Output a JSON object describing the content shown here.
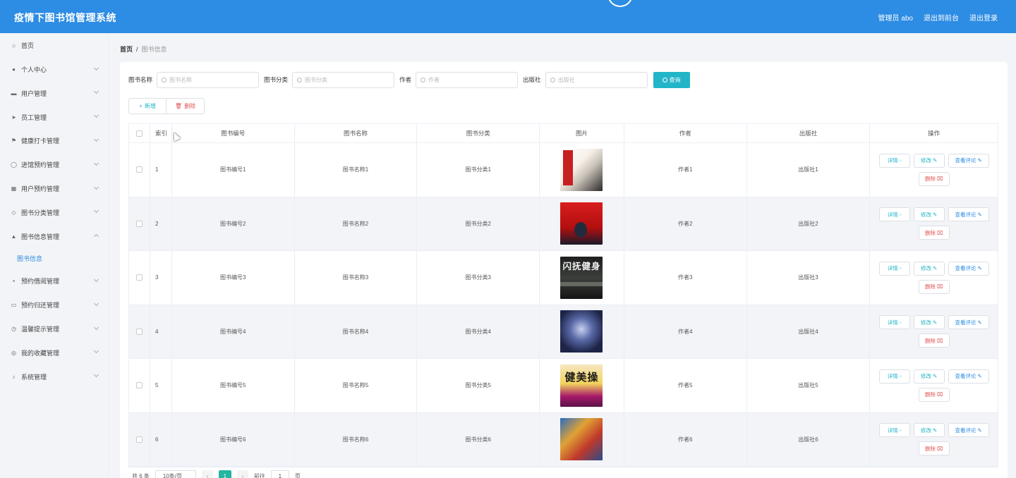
{
  "header": {
    "title": "疫情下图书馆管理系统",
    "admin_label": "管理员 abo",
    "back_front": "退出到前台",
    "logout": "退出登录"
  },
  "sidebar": {
    "items": [
      {
        "label": "首页",
        "icon": "home-icon",
        "has_arrow": false
      },
      {
        "label": "个人中心",
        "icon": "user-icon",
        "has_arrow": true
      },
      {
        "label": "用户管理",
        "icon": "id-card-icon",
        "has_arrow": true
      },
      {
        "label": "员工管理",
        "icon": "send-icon",
        "has_arrow": true
      },
      {
        "label": "健康打卡管理",
        "icon": "flag-icon",
        "has_arrow": true
      },
      {
        "label": "进馆预约管理",
        "icon": "power-icon",
        "has_arrow": true
      },
      {
        "label": "用户预约管理",
        "icon": "grid-icon",
        "has_arrow": true
      },
      {
        "label": "图书分类管理",
        "icon": "tag-icon",
        "has_arrow": true
      },
      {
        "label": "图书信息管理",
        "icon": "person-icon",
        "has_arrow": true,
        "expanded": true
      }
    ],
    "subitem": "图书信息",
    "items_after": [
      {
        "label": "预约借阅管理",
        "icon": "apps-icon"
      },
      {
        "label": "预约归还管理",
        "icon": "message-icon"
      },
      {
        "label": "温馨提示管理",
        "icon": "clock-icon"
      },
      {
        "label": "我的收藏管理",
        "icon": "compass-icon"
      },
      {
        "label": "系统管理",
        "icon": "mic-icon"
      }
    ]
  },
  "breadcrumb": {
    "home": "首页",
    "separator": "/",
    "current": "图书信息"
  },
  "search": {
    "fields": [
      {
        "label": "图书名称",
        "placeholder": "图书名称"
      },
      {
        "label": "图书分类",
        "placeholder": "图书分类"
      },
      {
        "label": "作者",
        "placeholder": "作者"
      },
      {
        "label": "出版社",
        "placeholder": "出版社"
      }
    ],
    "query_button": "查询"
  },
  "actions": {
    "add": "新增",
    "delete": "删除"
  },
  "table": {
    "headers": [
      "索引",
      "图书编号",
      "图书名称",
      "图书分类",
      "图片",
      "作者",
      "出版社",
      "操作"
    ],
    "rows": [
      {
        "index": "1",
        "no": "图书编号1",
        "name": "图书名称1",
        "category": "图书分类1",
        "author": "作者1",
        "publisher": "出版社1",
        "thumb_text": ""
      },
      {
        "index": "2",
        "no": "图书编号2",
        "name": "图书名称2",
        "category": "图书分类2",
        "author": "作者2",
        "publisher": "出版社2",
        "thumb_text": ""
      },
      {
        "index": "3",
        "no": "图书编号3",
        "name": "图书名称3",
        "category": "图书分类3",
        "author": "作者3",
        "publisher": "出版社3",
        "thumb_text": "闪抚健身"
      },
      {
        "index": "4",
        "no": "图书编号4",
        "name": "图书名称4",
        "category": "图书分类4",
        "author": "作者4",
        "publisher": "出版社4",
        "thumb_text": ""
      },
      {
        "index": "5",
        "no": "图书编号5",
        "name": "图书名称5",
        "category": "图书分类5",
        "author": "作者5",
        "publisher": "出版社5",
        "thumb_text": "健美操"
      },
      {
        "index": "6",
        "no": "图书编号6",
        "name": "图书名称6",
        "category": "图书分类6",
        "author": "作者6",
        "publisher": "出版社6",
        "thumb_text": ""
      }
    ],
    "ops": {
      "detail": "详情",
      "edit": "修改",
      "comment": "查看评论",
      "delete": "删除"
    }
  },
  "pagination": {
    "total": "共 6 条",
    "page_size": "10条/页",
    "current_page": "1",
    "goto_label": "前往",
    "goto_value": "1",
    "page_suffix": "页"
  },
  "colors": {
    "header_bg": "#2d8ce3",
    "accent": "#22b5c8",
    "danger": "#e25555"
  }
}
